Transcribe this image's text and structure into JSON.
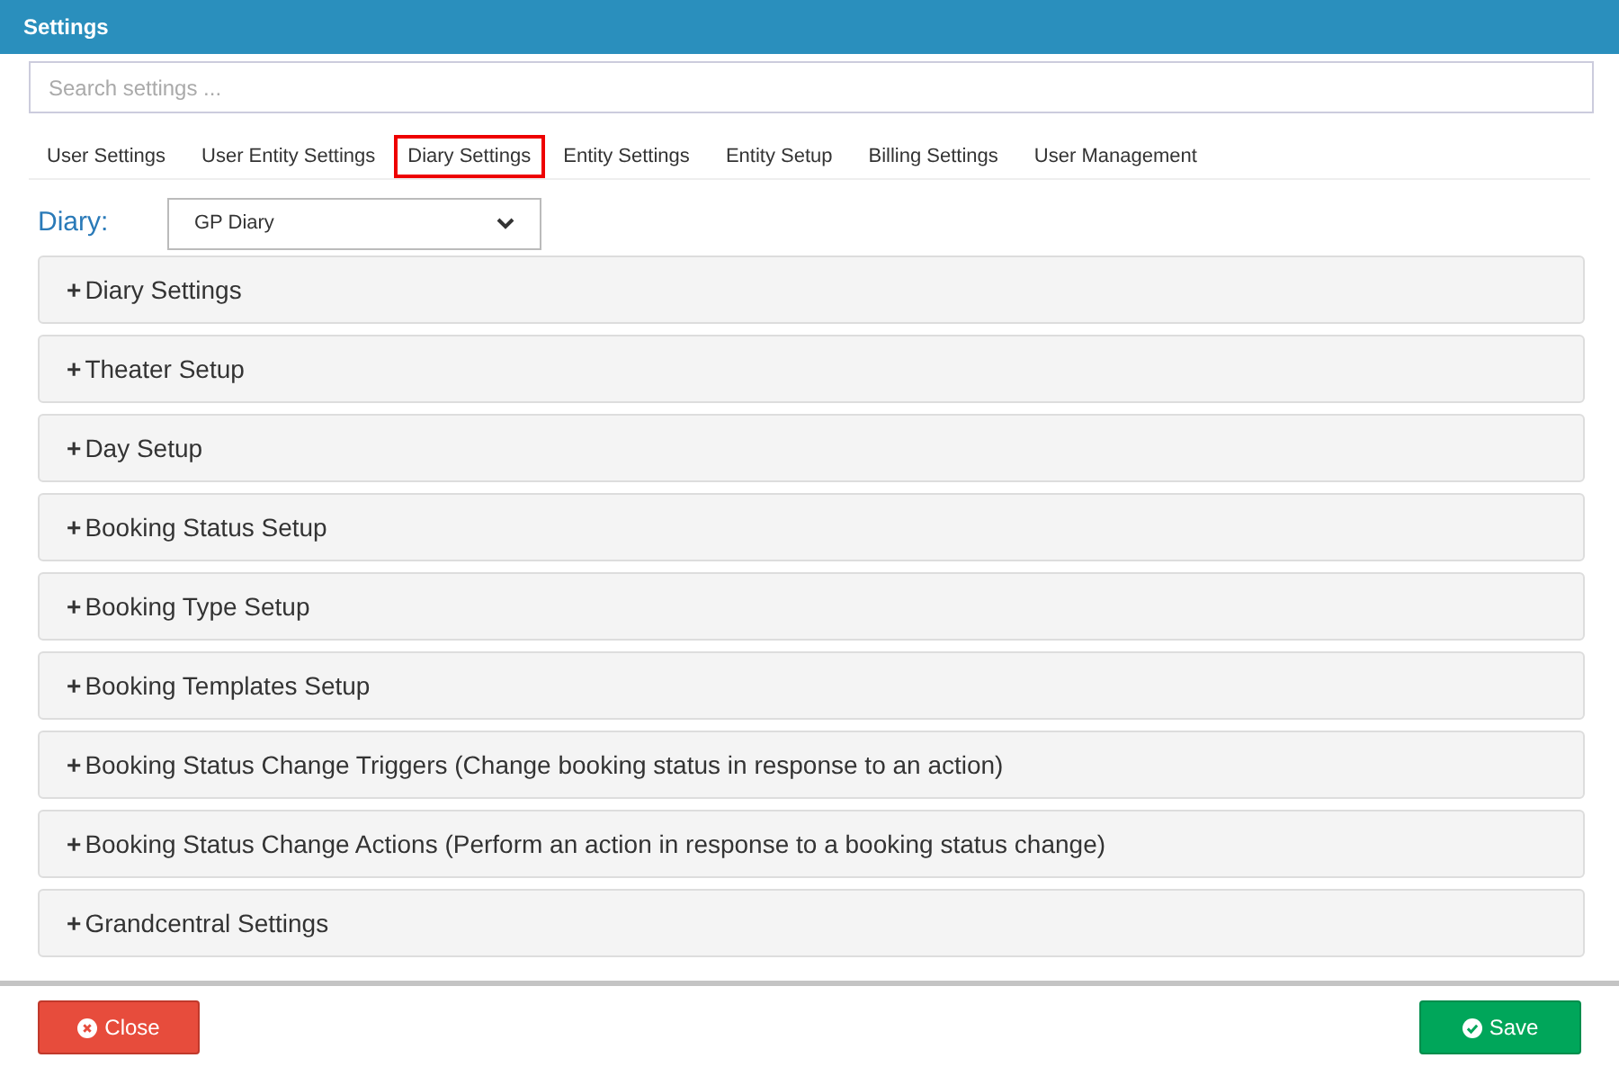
{
  "window": {
    "title": "Settings"
  },
  "search": {
    "placeholder": "Search settings ..."
  },
  "tabs": [
    {
      "label": "User Settings",
      "selected": false
    },
    {
      "label": "User Entity Settings",
      "selected": false
    },
    {
      "label": "Diary Settings",
      "selected": true
    },
    {
      "label": "Entity Settings",
      "selected": false
    },
    {
      "label": "Entity Setup",
      "selected": false
    },
    {
      "label": "Billing Settings",
      "selected": false
    },
    {
      "label": "User Management",
      "selected": false
    }
  ],
  "diary": {
    "label": "Diary:",
    "value": "GP Diary"
  },
  "panels": [
    {
      "toggle": "+",
      "title": "Diary Settings"
    },
    {
      "toggle": "+",
      "title": "Theater Setup"
    },
    {
      "toggle": "+",
      "title": "Day Setup"
    },
    {
      "toggle": "+",
      "title": "Booking Status Setup"
    },
    {
      "toggle": "+",
      "title": "Booking Type Setup"
    },
    {
      "toggle": "+",
      "title": "Booking Templates Setup"
    },
    {
      "toggle": "+",
      "title": "Booking Status Change Triggers (Change booking status in response to an action)"
    },
    {
      "toggle": "+",
      "title": "Booking Status Change Actions (Perform an action in response to a booking status change)"
    },
    {
      "toggle": "+",
      "title": "Grandcentral Settings"
    }
  ],
  "buttons": {
    "close": "Close",
    "save": "Save"
  }
}
